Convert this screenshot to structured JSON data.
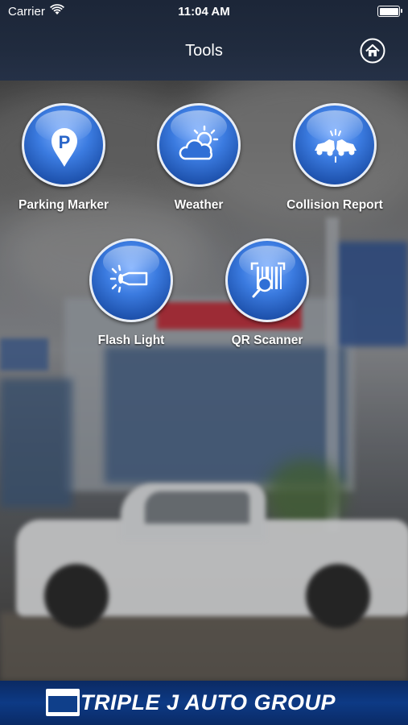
{
  "status_bar": {
    "carrier": "Carrier",
    "time": "11:04 AM"
  },
  "nav": {
    "title": "Tools",
    "home_icon": "home-icon"
  },
  "tools": [
    {
      "label": "Parking Marker",
      "icon": "parking-marker-icon"
    },
    {
      "label": "Weather",
      "icon": "weather-icon"
    },
    {
      "label": "Collision Report",
      "icon": "collision-icon"
    },
    {
      "label": "Flash Light",
      "icon": "flashlight-icon"
    },
    {
      "label": "QR Scanner",
      "icon": "qr-scanner-icon"
    }
  ],
  "footer": {
    "brand": "TRIPLE J AUTO GROUP"
  },
  "colors": {
    "accent": "#2f6fd6",
    "header": "#1c2638",
    "footer": "#0d3a85"
  }
}
